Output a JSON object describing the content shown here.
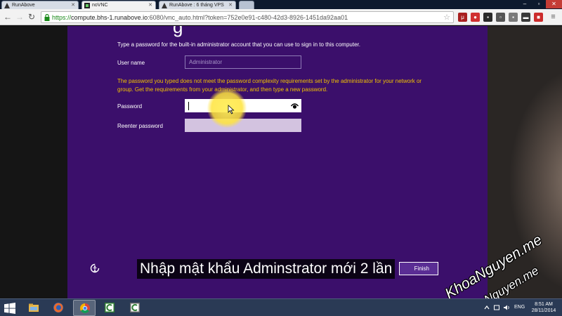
{
  "browser": {
    "tabs": [
      {
        "label": "RunAbove",
        "active": false,
        "icon": "runabove-icon"
      },
      {
        "label": "noVNC",
        "active": true,
        "icon": "novnc-icon"
      },
      {
        "label": "RunAbove : 6 tháng VPS",
        "active": false,
        "icon": "page-icon"
      }
    ],
    "url_scheme": "https://",
    "url_host": "compute.bhs-1.runabove.io",
    "url_rest": ":6080/vnc_auto.html?token=752e0e91-c480-42d3-8926-1451da92aa01",
    "extensions": [
      "ublock-icon",
      "extension-icon",
      "extension-icon",
      "extension-icon",
      "extension-icon",
      "extension-icon",
      "extension-icon",
      "menu-icon"
    ]
  },
  "setup": {
    "title_fragment": "g",
    "intro": "Type a password for the built-in administrator account that you can use to sign in to this computer.",
    "username_label": "User name",
    "username_value": "Administrator",
    "warning": "The password you typed does not meet the password complexity requirements set by the administrator for your network or group. Get the requirements from your administrator, and then type a new password.",
    "password_label": "Password",
    "password_value": "",
    "reenter_label": "Reenter password",
    "reenter_value": "",
    "finish_label": "Finish"
  },
  "overlay": {
    "subtitle": "Nhập mật khẩu Adminstrator mới 2 lần",
    "watermark": "KhoaNguyen.me"
  },
  "taskbar": {
    "apps": [
      "file-explorer-icon",
      "firefox-icon",
      "chrome-icon",
      "camtasia-icon",
      "camtasia-recorder-icon"
    ],
    "language": "ENG",
    "time": "8:51 AM",
    "date": "28/11/2014"
  },
  "colors": {
    "setup_background": "#3b0f6b",
    "warning_text": "#f2c200",
    "taskbar": "#2a3a55"
  }
}
